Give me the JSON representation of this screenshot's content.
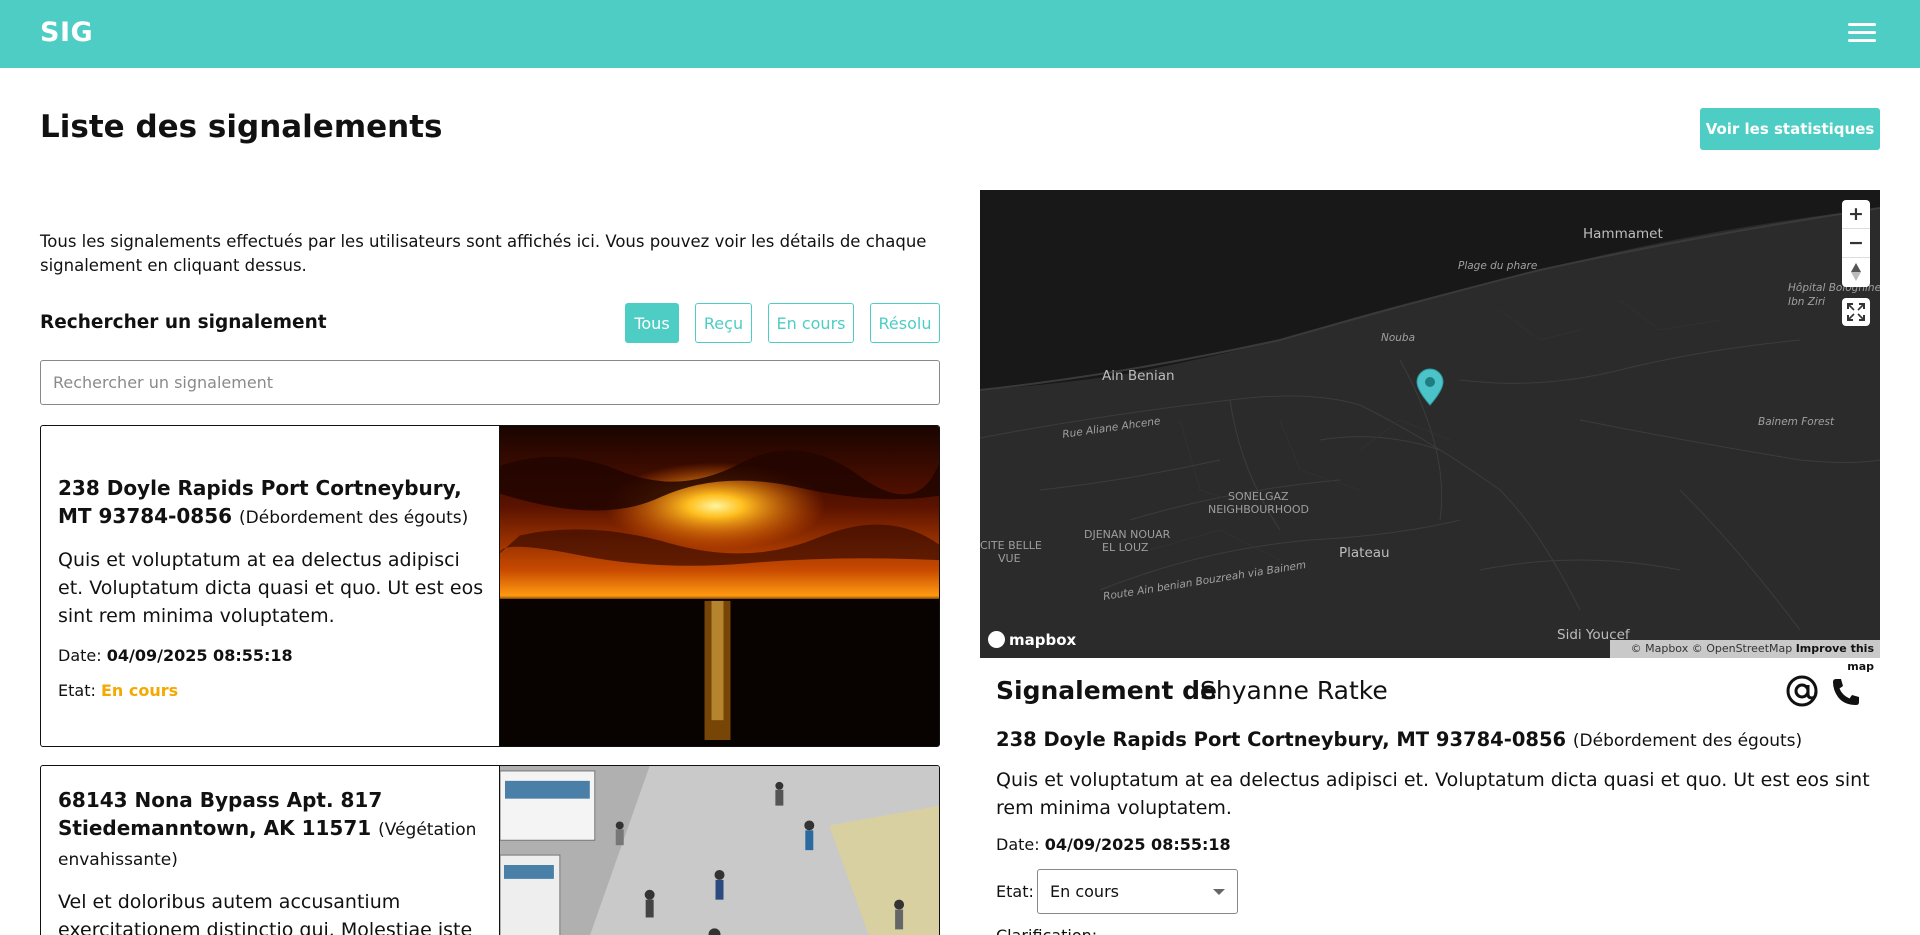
{
  "header": {
    "brand": "SIG",
    "menu_icon": "hamburger-menu-icon"
  },
  "page": {
    "title": "Liste des signalements",
    "stats_button": "Voir les statistiques",
    "intro": "Tous les signalements effectués par les utilisateurs sont affichés ici. Vous pouvez voir les détails de chaque signalement en cliquant dessus.",
    "search_label": "Rechercher un signalement",
    "search_placeholder": "Rechercher un signalement",
    "filters": [
      {
        "label": "Tous",
        "active": true
      },
      {
        "label": "Reçu",
        "active": false
      },
      {
        "label": "En cours",
        "active": false
      },
      {
        "label": "Résolu",
        "active": false
      }
    ]
  },
  "reports": [
    {
      "address": "238 Doyle Rapids Port Cortneybury, MT 93784-0856",
      "category": "(Débordement des égouts)",
      "description": "Quis et voluptatum at ea delectus adipisci et. Voluptatum dicta quasi et quo. Ut est eos sint rem minima voluptatem.",
      "date_label": "Date:",
      "date": "04/09/2025 08:55:18",
      "state_label": "Etat:",
      "state": "En cours",
      "image": "sunset-over-sea"
    },
    {
      "address": "68143 Nona Bypass Apt. 817 Stiedemanntown, AK 11571",
      "category": "(Végétation envahissante)",
      "description": "Vel et doloribus autem accusantium exercitationem distinctio qui. Molestiae iste",
      "image": "street-crowd"
    }
  ],
  "map": {
    "labels": [
      "Hammamet",
      "Plage du phare",
      "Hôpital Bologhine",
      "Ibn Ziri",
      "Nouba",
      "Ain Benian",
      "Rue Aliane Ahcene",
      "Bainem Forest",
      "SONELGAZ",
      "NEIGHBOURHOOD",
      "DJENAN NOUAR",
      "EL LOUZ",
      "CITE BELLE",
      "VUE",
      "Plateau",
      "Route Ain benian Bouzreah via Bainem",
      "Sidi Youcef"
    ],
    "zoom_in": "+",
    "zoom_out": "−",
    "logo": "mapbox",
    "attribution": "© Mapbox © OpenStreetMap",
    "improve": "Improve this map"
  },
  "detail": {
    "title": "Signalement de",
    "name": "Shyanne Ratke",
    "address": "238 Doyle Rapids Port Cortneybury, MT 93784-0856",
    "category": "(Débordement des égouts)",
    "description": "Quis et voluptatum at ea delectus adipisci et. Voluptatum dicta quasi et quo. Ut est eos sint rem minima voluptatem.",
    "date_label": "Date:",
    "date": "04/09/2025 08:55:18",
    "state_label": "Etat:",
    "state_value": "En cours",
    "clarification_label": "Clarification:"
  },
  "colors": {
    "accent": "#4ecdc4",
    "state_in_progress": "#f5a800"
  }
}
